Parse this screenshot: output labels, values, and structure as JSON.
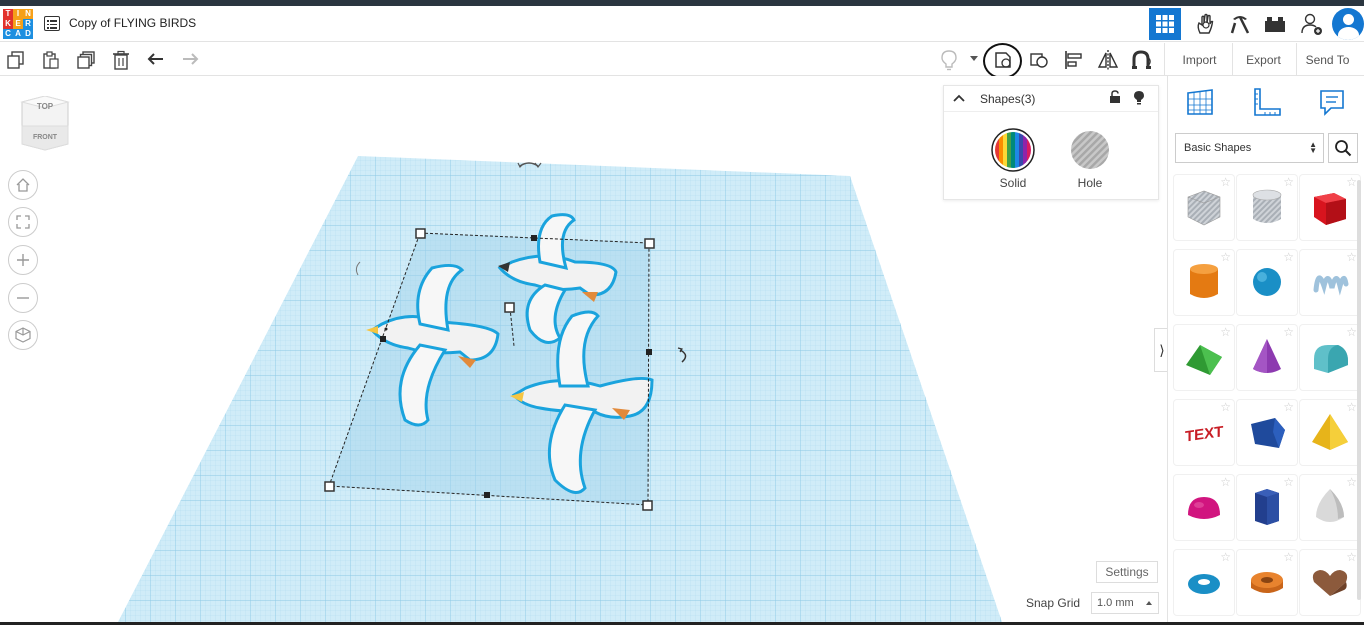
{
  "app": {
    "document_title": "Copy of FLYING BIRDS",
    "logo_letters": [
      "T",
      "I",
      "N",
      "K",
      "E",
      "R",
      "C",
      "A",
      "D"
    ],
    "logo_colors": [
      "#e2322d",
      "#f6a019",
      "#f6a019",
      "#e2322d",
      "#f6a019",
      "#1d8fe0",
      "#1d8fe0",
      "#1d8fe0",
      "#1d8fe0"
    ]
  },
  "header": {
    "buttons": [
      {
        "icon": "grid-view-icon",
        "active": true
      },
      {
        "icon": "hand-sim-icon",
        "active": false
      },
      {
        "icon": "pickaxe-icon",
        "active": false
      },
      {
        "icon": "bricks-icon",
        "active": false
      },
      {
        "icon": "add-user-icon",
        "active": false
      },
      {
        "icon": "user-avatar-icon",
        "active": false
      }
    ]
  },
  "toolbar": {
    "left_tools": [
      "copy-icon",
      "paste-icon",
      "duplicate-icon",
      "delete-icon",
      "undo-icon",
      "redo-icon"
    ],
    "right_tools": [
      "light-bulb-icon",
      "group-icon",
      "ungroup-icon",
      "align-icon",
      "mirror-icon",
      "cruise-magnet-icon"
    ],
    "import_label": "Import",
    "export_label": "Export",
    "send_to_label": "Send To"
  },
  "viewcube": {
    "top_label": "TOP",
    "front_label": "FRONT"
  },
  "nav": [
    "home-icon",
    "fit-view-icon",
    "zoom-in-icon",
    "zoom-out-icon",
    "perspective-icon"
  ],
  "shapes_panel": {
    "title": "Shapes(3)",
    "solid_label": "Solid",
    "hole_label": "Hole"
  },
  "workplane": {
    "settings_label": "Settings",
    "snap_grid_label": "Snap Grid",
    "snap_grid_value": "1.0 mm",
    "selection_count": 3
  },
  "sidebar": {
    "tabs": [
      "workplane-grid-icon",
      "ruler-icon",
      "notes-icon"
    ],
    "library": "Basic Shapes",
    "shapes": [
      "box-hole",
      "cylinder-hole",
      "box",
      "cylinder",
      "sphere",
      "scribble",
      "roof",
      "cone",
      "round-roof",
      "text",
      "polygon",
      "pyramid",
      "half-sphere",
      "hexagonal-prism",
      "paraboloid",
      "torus",
      "tube",
      "heart"
    ]
  },
  "colors": {
    "accent": "#1477d1",
    "workplane": "#c9e8f6",
    "grid_line": "#8fcbe6",
    "selection_outline": "#1aa3dd"
  }
}
